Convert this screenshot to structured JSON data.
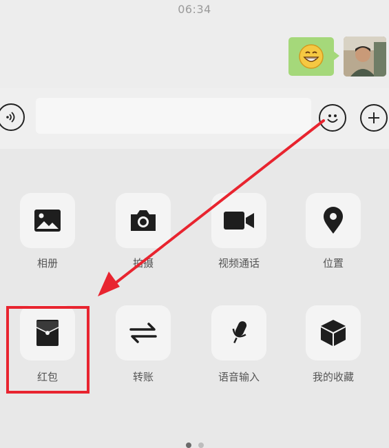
{
  "status_bar": {
    "time": "06:34"
  },
  "chat": {
    "message_icon": "grinning-emoji-sticker",
    "avatar_icon": "user-photo"
  },
  "input_bar": {
    "voice_icon": "voice-icon",
    "emoji_icon": "emoji-icon",
    "plus_icon": "plus-icon"
  },
  "panel": {
    "items": [
      {
        "label": "相册",
        "icon": "image-icon"
      },
      {
        "label": "拍摄",
        "icon": "camera-icon"
      },
      {
        "label": "视频通话",
        "icon": "video-icon"
      },
      {
        "label": "位置",
        "icon": "location-icon"
      },
      {
        "label": "红包",
        "icon": "red-packet-icon"
      },
      {
        "label": "转账",
        "icon": "transfer-icon"
      },
      {
        "label": "语音输入",
        "icon": "microphone-icon"
      },
      {
        "label": "我的收藏",
        "icon": "favorites-box-icon"
      }
    ],
    "page_count": 2,
    "current_page": 1
  },
  "annotation": {
    "color": "#e8242f",
    "highlight_target": "红包"
  }
}
